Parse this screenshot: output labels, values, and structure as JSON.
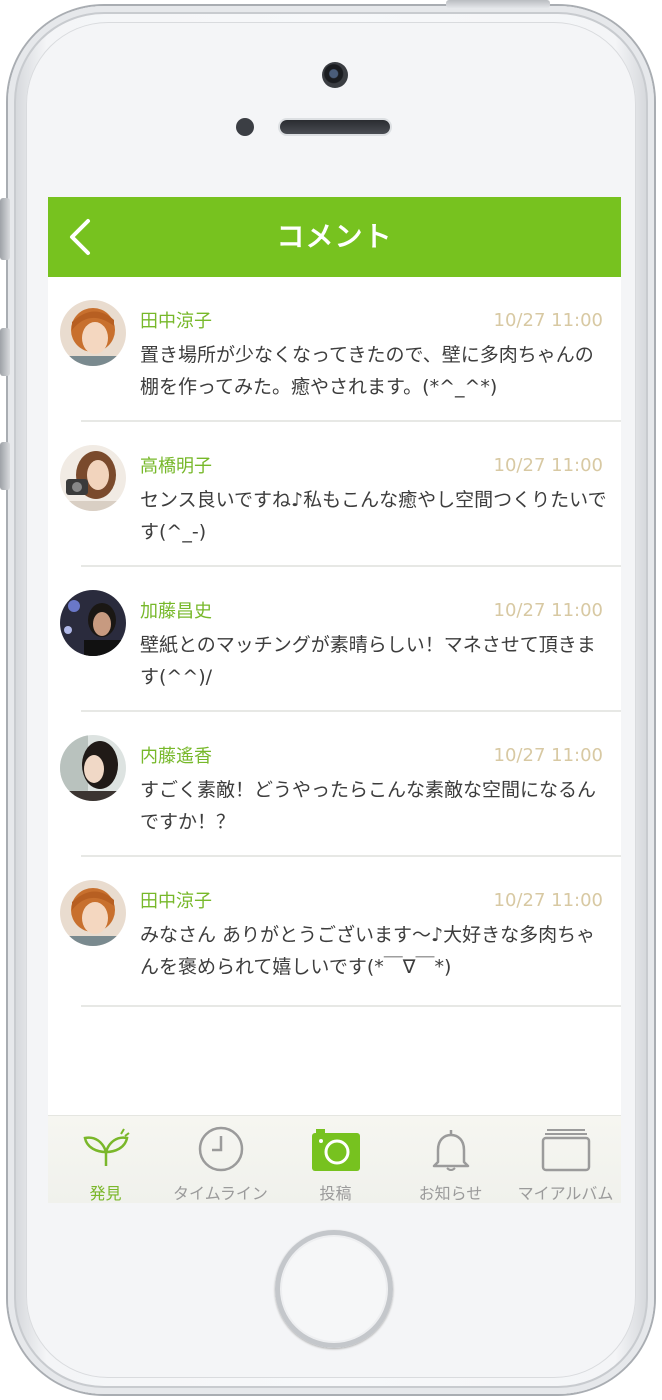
{
  "header": {
    "title": "コメント"
  },
  "comments": [
    {
      "name": "田中涼子",
      "time": "10/27 11:00",
      "text": "置き場所が少なくなってきたので、壁に多肉ちゃんの棚を作ってみた。癒やされます。(*^_^*)"
    },
    {
      "name": "高橋明子",
      "time": "10/27 11:00",
      "text": "センス良いですね♪私もこんな癒やし空間つくりたいです(^_-)"
    },
    {
      "name": "加藤昌史",
      "time": "10/27 11:00",
      "text": "壁紙とのマッチングが素晴らしい！マネさせて頂きます(^^)/"
    },
    {
      "name": "内藤遙香",
      "time": "10/27 11:00",
      "text": "すごく素敵！どうやったらこんな素敵な空間になるんですか！？"
    },
    {
      "name": "田中涼子",
      "time": "10/27 11:00",
      "text": "みなさん ありがとうございます〜♪大好きな多肉ちゃんを褒められて嬉しいです(*￣∇￣*)"
    }
  ],
  "tabs": [
    {
      "label": "発見",
      "icon": "sprout-icon",
      "active": true
    },
    {
      "label": "タイムライン",
      "icon": "clock-icon"
    },
    {
      "label": "投稿",
      "icon": "camera-icon"
    },
    {
      "label": "お知らせ",
      "icon": "bell-icon"
    },
    {
      "label": "マイアルバム",
      "icon": "album-icon"
    }
  ],
  "colors": {
    "accent": "#77c21f",
    "name": "#77b82a",
    "time": "#d8c9a3",
    "text": "#3d3d3d",
    "inactive": "#9b9b9b"
  }
}
